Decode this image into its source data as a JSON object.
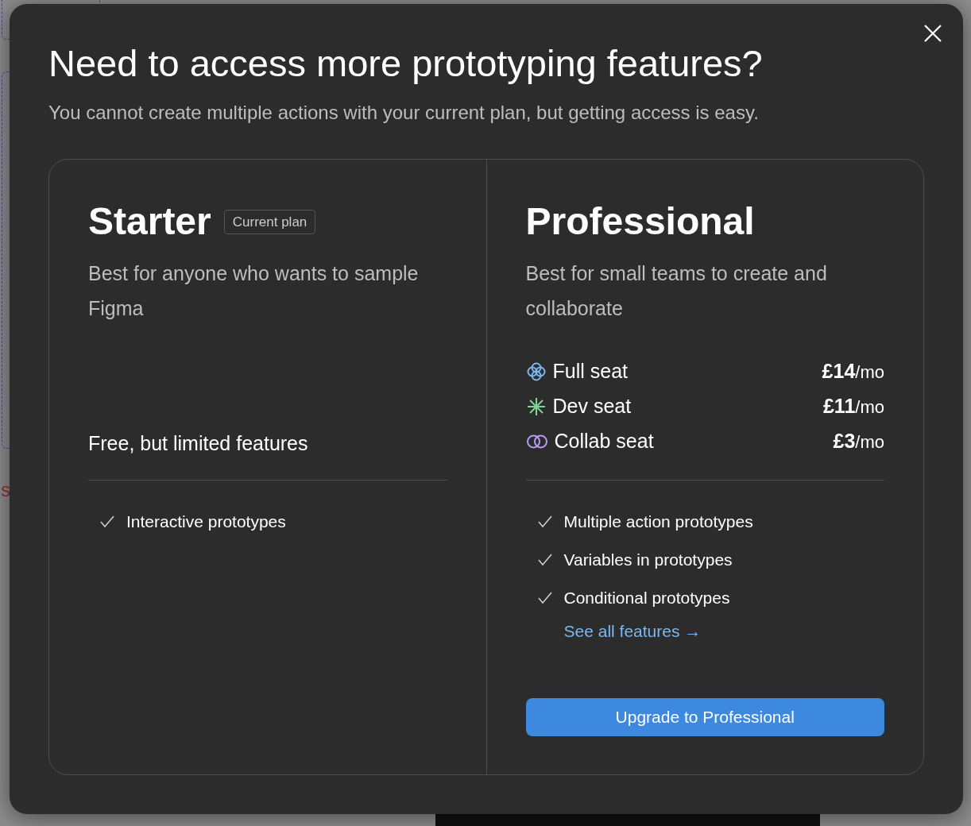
{
  "background": {
    "canvas_label": "S"
  },
  "dialog": {
    "title": "Need to access more prototyping features?",
    "subtitle": "You cannot create multiple actions with your current plan, but getting access is easy.",
    "plans": [
      {
        "name": "Starter",
        "badge": "Current plan",
        "description": "Best for anyone who wants to sample Figma",
        "price_note": "Free, but limited features",
        "features": [
          "Interactive prototypes"
        ]
      },
      {
        "name": "Professional",
        "description": "Best for small teams to create and collaborate",
        "seats": [
          {
            "kind": "full",
            "label": "Full seat",
            "price": "**£14**/mo",
            "color": "#7cb7f0"
          },
          {
            "kind": "dev",
            "label": "Dev seat",
            "price": "**£11**/mo",
            "color": "#7fd49a"
          },
          {
            "kind": "collab",
            "label": "Collab seat",
            "price": "**£3**/mo",
            "color": "#b99af0"
          }
        ],
        "features": [
          "Multiple action prototypes",
          "Variables in prototypes",
          "Conditional prototypes"
        ],
        "link": "See all features →",
        "button": "Upgrade to Professional"
      }
    ]
  }
}
